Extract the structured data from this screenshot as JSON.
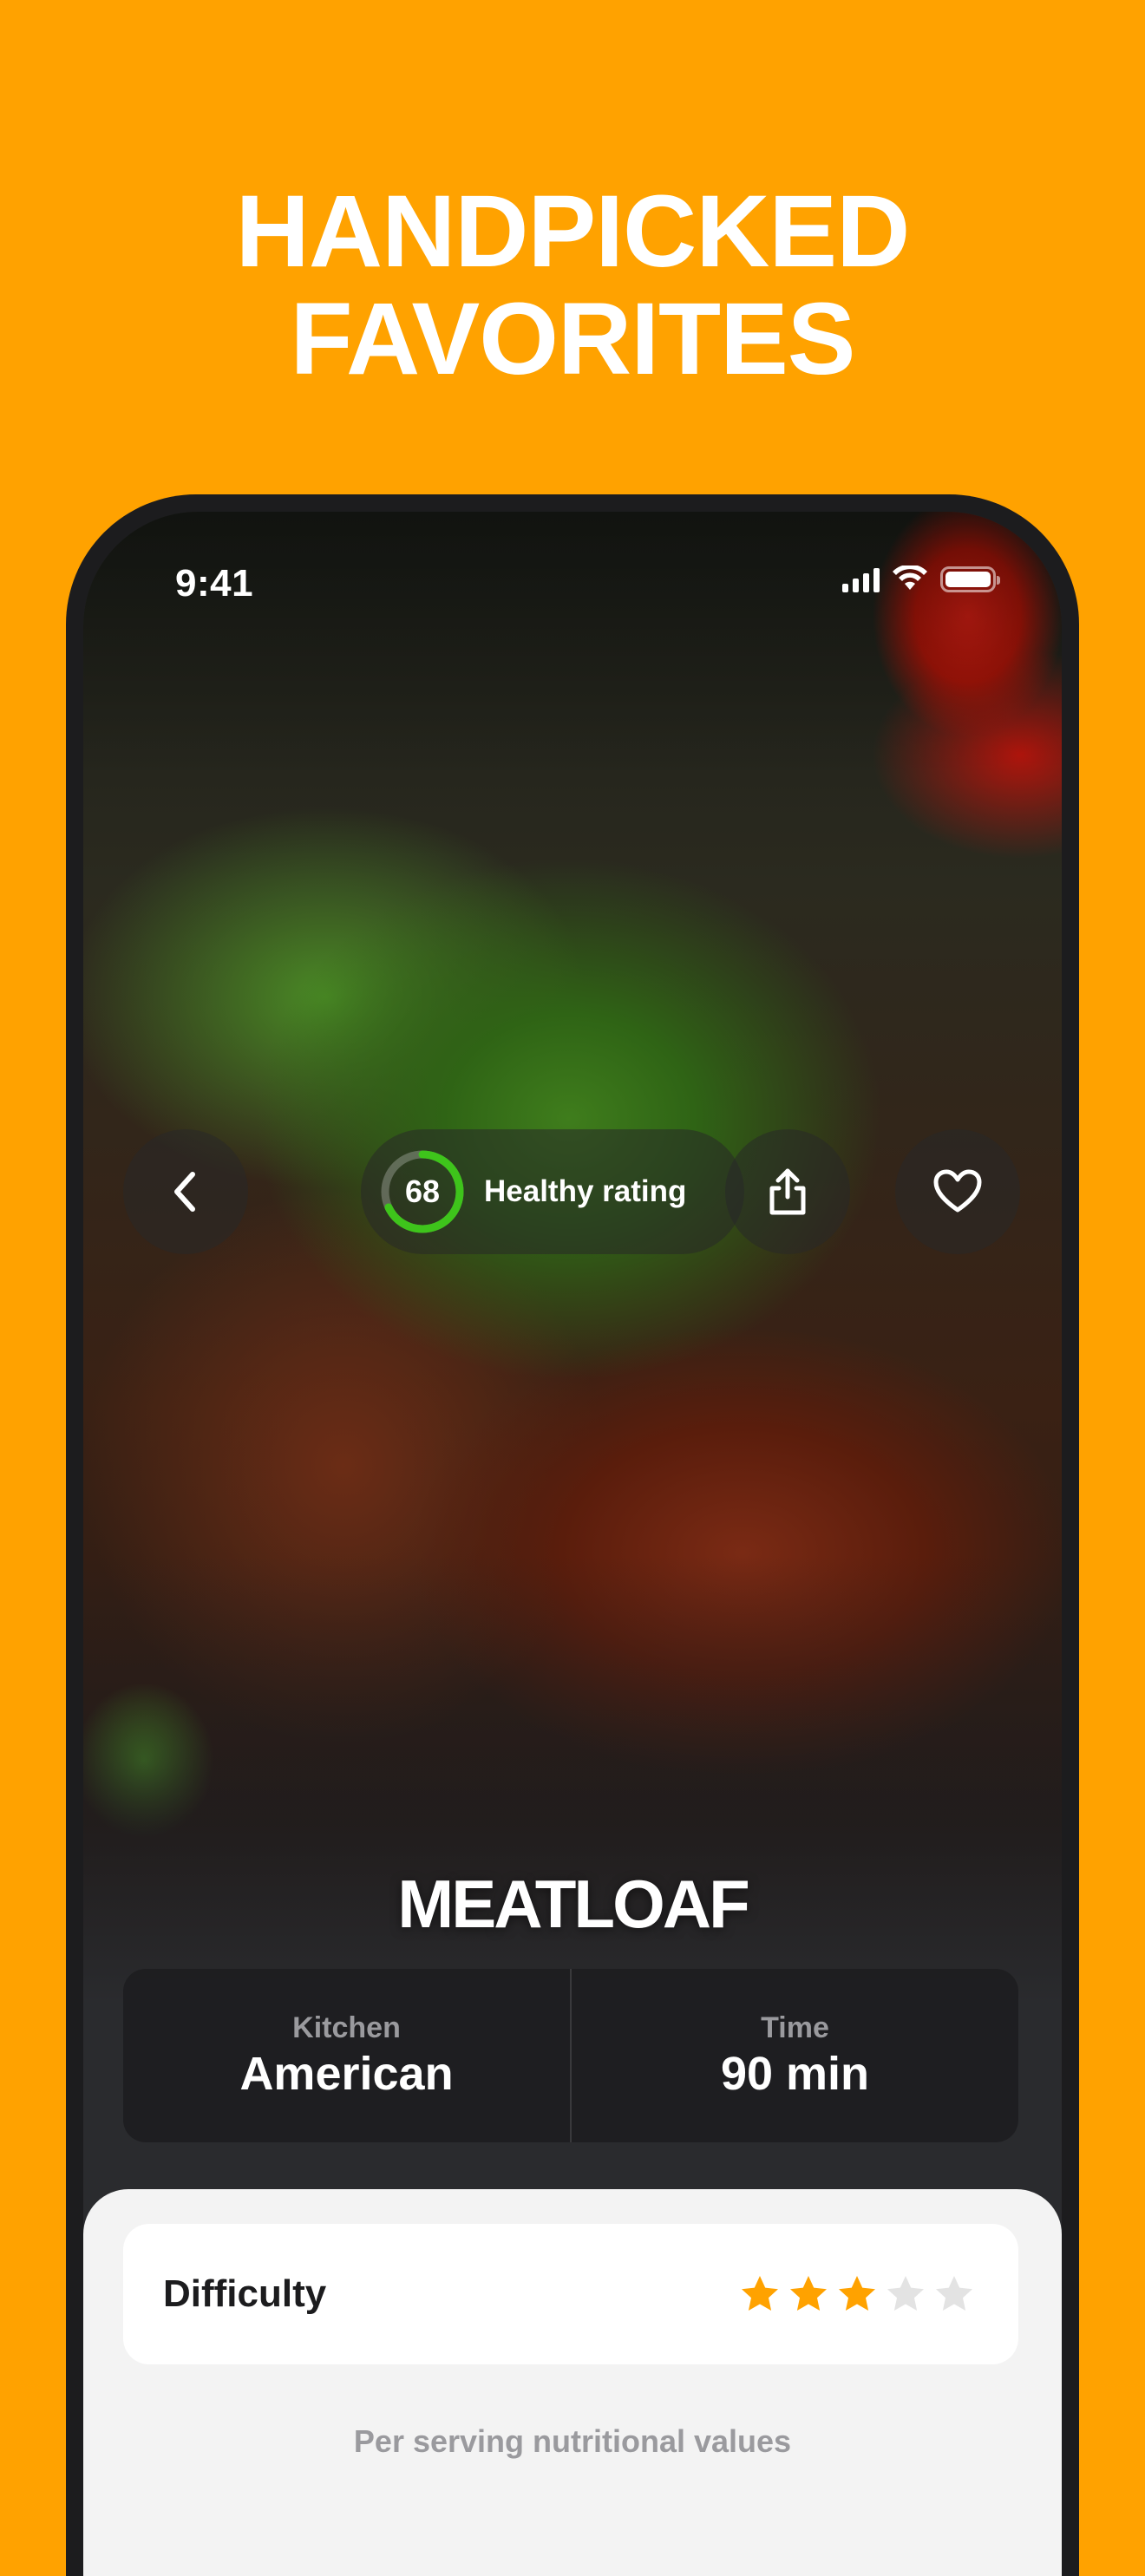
{
  "headline": {
    "line1": "HANDPICKED",
    "line2": "FAVORITES"
  },
  "colors": {
    "background": "#FFA200",
    "ring_accent": "#3ec41b",
    "star_filled": "#FFA200",
    "star_empty": "#e3e3e3"
  },
  "statusbar": {
    "time": "9:41",
    "icons": [
      "signal-icon",
      "wifi-icon",
      "battery-icon"
    ]
  },
  "nav": {
    "back_icon": "chevron-left-icon",
    "share_icon": "share-icon",
    "favorite_icon": "heart-icon",
    "healthy_rating": {
      "value": "68",
      "label": "Healthy rating",
      "fraction": 0.68
    }
  },
  "recipe": {
    "title": "MEATLOAF",
    "kitchen_label": "Kitchen",
    "kitchen_value": "American",
    "time_label": "Time",
    "time_value": "90 min"
  },
  "details": {
    "difficulty_label": "Difficulty",
    "difficulty_rating": 3,
    "difficulty_max": 5,
    "nutrition_heading": "Per serving nutritional values"
  }
}
